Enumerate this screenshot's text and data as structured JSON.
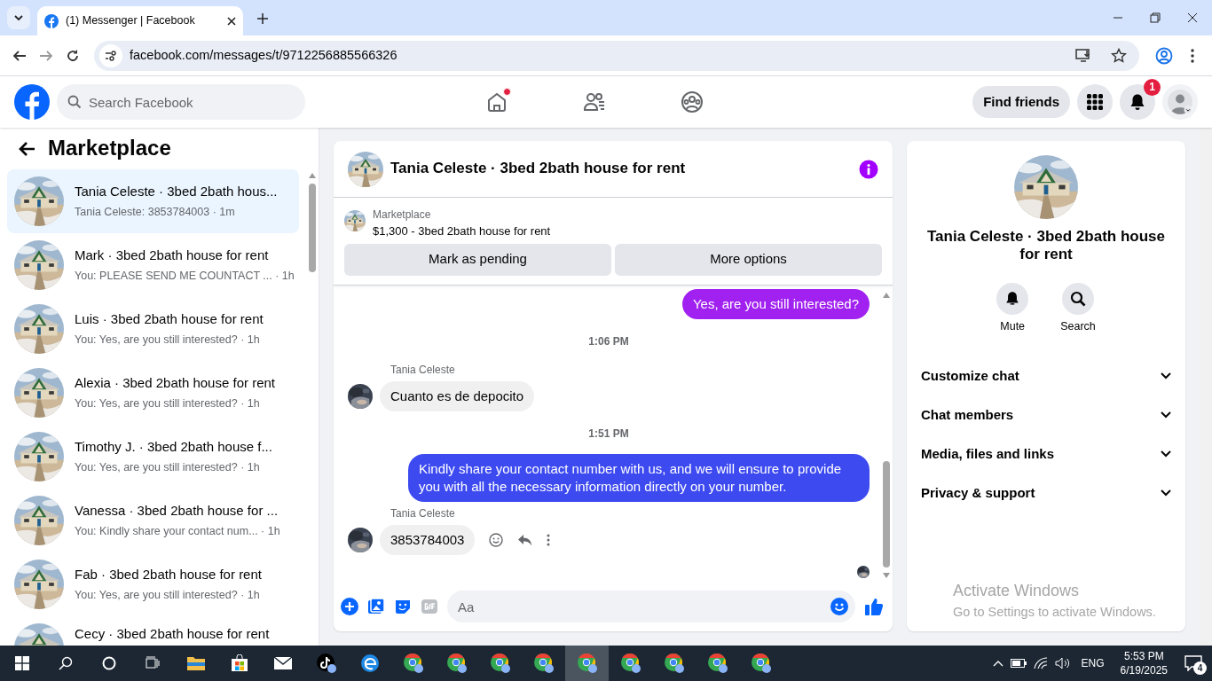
{
  "browser": {
    "tab_title": "(1) Messenger | Facebook",
    "url": "facebook.com/messages/t/9712256885566326"
  },
  "header": {
    "search_placeholder": "Search Facebook",
    "nav": [
      {
        "kind": "home",
        "dot": true
      },
      {
        "kind": "friends",
        "dot": false
      },
      {
        "kind": "groups",
        "dot": false
      }
    ],
    "find_friends": "Find friends",
    "notification_count": "1"
  },
  "sidebar": {
    "title": "Marketplace",
    "conversations": [
      {
        "title": "Tania Celeste · 3bed 2bath hous...",
        "preview": "Tania Celeste: 3853784003 · 1m",
        "selected": true
      },
      {
        "title": "Mark · 3bed 2bath house for rent",
        "preview": "You: PLEASE SEND ME COUNTACT ... · 1h",
        "selected": false
      },
      {
        "title": "Luis · 3bed 2bath house for rent",
        "preview": "You: Yes, are you still interested? · 1h",
        "selected": false
      },
      {
        "title": "Alexia · 3bed 2bath house for rent",
        "preview": "You: Yes, are you still interested? · 1h",
        "selected": false
      },
      {
        "title": "Timothy J. · 3bed 2bath house f...",
        "preview": "You: Yes, are you still interested? · 1h",
        "selected": false
      },
      {
        "title": "Vanessa · 3bed 2bath house for ...",
        "preview": "You: Kindly share your contact num... · 1h",
        "selected": false
      },
      {
        "title": "Fab · 3bed 2bath house for rent",
        "preview": "You: Yes, are you still interested? · 1h",
        "selected": false
      },
      {
        "title": "Cecy · 3bed 2bath house for rent",
        "selected": false
      }
    ]
  },
  "chat": {
    "title": "Tania Celeste · 3bed 2bath house for rent",
    "listing": {
      "label": "Marketplace",
      "text": "$1,300 - 3bed 2bath house for rent"
    },
    "actions": [
      "Mark as pending",
      "More options"
    ],
    "messages": [
      {
        "kind": "outgoing",
        "text": "Yes, are you still interested?",
        "color": "#a121f0"
      },
      {
        "kind": "time",
        "text": "1:06 PM"
      },
      {
        "kind": "incoming",
        "sender": "Tania Celeste",
        "text": "Cuanto es de depocito",
        "show_actions": false
      },
      {
        "kind": "time",
        "text": "1:51 PM"
      },
      {
        "kind": "outgoing",
        "text": "Kindly share your contact number with us, and we will ensure to provide you with all the necessary information directly on your number.",
        "color": "#3d4af0"
      },
      {
        "kind": "incoming",
        "sender": "Tania Celeste",
        "text": "3853784003",
        "show_actions": true
      }
    ],
    "composer_placeholder": "Aa"
  },
  "details": {
    "name": "Tania Celeste · 3bed 2bath house for rent",
    "actions": [
      {
        "kind": "bell",
        "label": "Mute"
      },
      {
        "kind": "search",
        "label": "Search"
      }
    ],
    "sections": [
      {
        "label": "Customize chat",
        "expanded": false
      },
      {
        "label": "Chat members",
        "expanded": false
      },
      {
        "label": "Media, files and links",
        "expanded": false
      },
      {
        "label": "Privacy & support",
        "expanded": false
      }
    ]
  },
  "activation_notice": {
    "title": "Activate Windows",
    "text": "Go to Settings to activate Windows."
  },
  "taskbar": {
    "apps": [
      {
        "kind": "search",
        "selected": false
      },
      {
        "kind": "cortana",
        "selected": false
      },
      {
        "kind": "taskview",
        "selected": false
      },
      {
        "kind": "files",
        "selected": false
      },
      {
        "kind": "store",
        "selected": false
      },
      {
        "kind": "mail",
        "selected": false
      },
      {
        "kind": "tiktok",
        "selected": false
      },
      {
        "kind": "edge",
        "selected": false
      },
      {
        "kind": "chrome",
        "selected": false
      },
      {
        "kind": "chrome",
        "selected": false
      },
      {
        "kind": "chrome",
        "selected": false
      },
      {
        "kind": "chrome",
        "selected": false
      },
      {
        "kind": "chrome",
        "selected": true
      },
      {
        "kind": "chrome",
        "selected": false
      },
      {
        "kind": "chrome",
        "selected": false
      },
      {
        "kind": "chrome",
        "selected": false
      },
      {
        "kind": "chrome",
        "selected": false
      }
    ],
    "language": "ENG",
    "time": "5:53 PM",
    "date": "6/19/2025",
    "notifications": "4"
  }
}
